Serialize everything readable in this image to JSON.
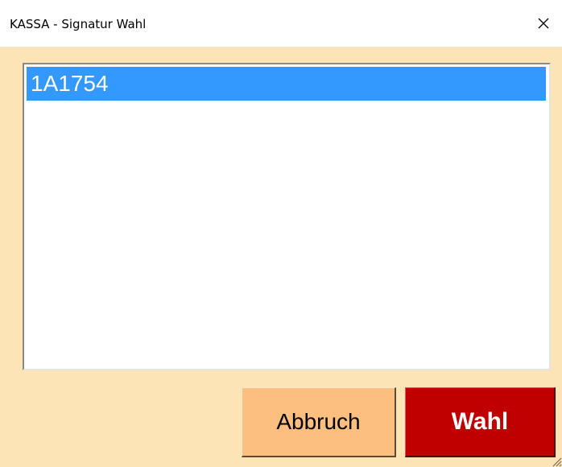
{
  "window": {
    "title": "KASSA - Signatur Wahl",
    "close_icon": "close-icon"
  },
  "list": {
    "items": [
      {
        "label": "1A1754",
        "selected": true
      }
    ],
    "selected_color": "#3399ff"
  },
  "buttons": {
    "cancel_label": "Abbruch",
    "select_label": "Wahl"
  },
  "colors": {
    "window_bg": "#fde4b7",
    "cancel_bg": "#fdbf80",
    "select_bg": "#c00000"
  }
}
